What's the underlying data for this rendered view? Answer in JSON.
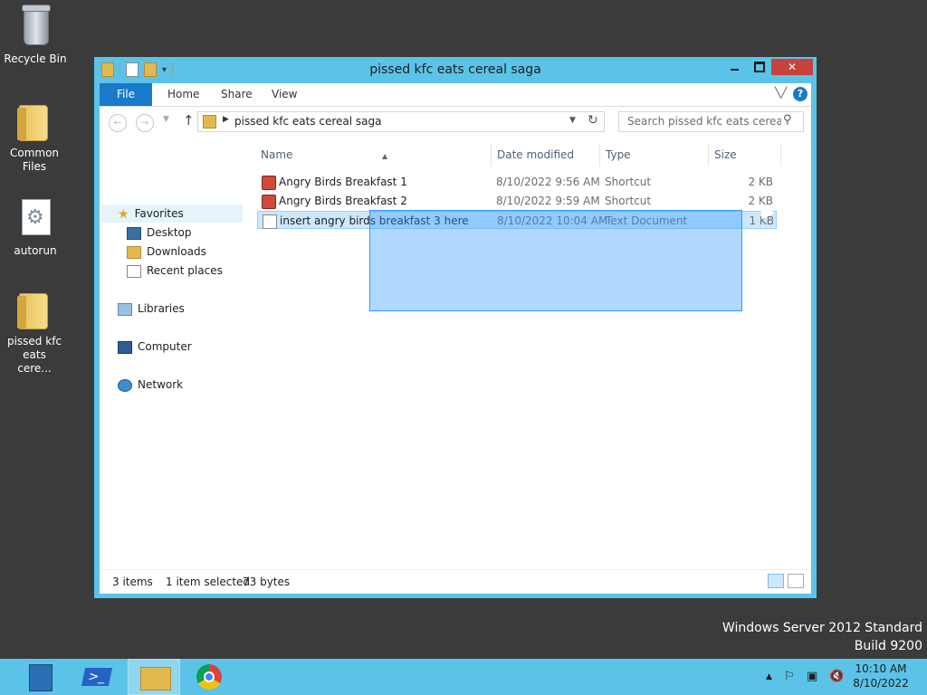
{
  "desktop": {
    "icons": [
      {
        "label": "Recycle Bin"
      },
      {
        "label": "Common Files"
      },
      {
        "label": "autorun"
      },
      {
        "label": "pissed kfc eats cere..."
      }
    ],
    "watermark": {
      "line1": "Windows Server 2012 Standard",
      "line2": "Build 9200"
    }
  },
  "window": {
    "title": "pissed kfc eats cereal saga",
    "ribbon": {
      "tabs": [
        "File",
        "Home",
        "Share",
        "View"
      ]
    },
    "address": {
      "path": "pissed kfc eats cereal saga",
      "search_placeholder": "Search pissed kfc eats cereal s..."
    },
    "nav": {
      "favorites": "Favorites",
      "fav_items": [
        "Desktop",
        "Downloads",
        "Recent places"
      ],
      "libraries": "Libraries",
      "computer": "Computer",
      "network": "Network"
    },
    "columns": {
      "name": "Name",
      "date": "Date modified",
      "type": "Type",
      "size": "Size"
    },
    "files": [
      {
        "name": "Angry Birds Breakfast 1",
        "date": "8/10/2022 9:56 AM",
        "type": "Shortcut",
        "size": "2 KB",
        "icon": "shortcut-icon"
      },
      {
        "name": "Angry Birds Breakfast 2",
        "date": "8/10/2022 9:59 AM",
        "type": "Shortcut",
        "size": "2 KB",
        "icon": "shortcut-icon"
      },
      {
        "name": "insert angry birds breakfast 3 here",
        "date": "8/10/2022 10:04 AM",
        "type": "Text Document",
        "size": "1 KB",
        "icon": "text-document-icon",
        "selected": true
      }
    ],
    "status": {
      "items": "3 items",
      "selected": "1 item selected",
      "bytes": "73 bytes"
    }
  },
  "taskbar": {
    "clock_time": "10:10 AM",
    "clock_date": "8/10/2022"
  },
  "colors": {
    "window_frame": "#5bc3e8",
    "desktop": "#3b3b3b",
    "file_tab": "#1979ca",
    "selection": "#cce8ff",
    "close_button": "#c7423a"
  }
}
